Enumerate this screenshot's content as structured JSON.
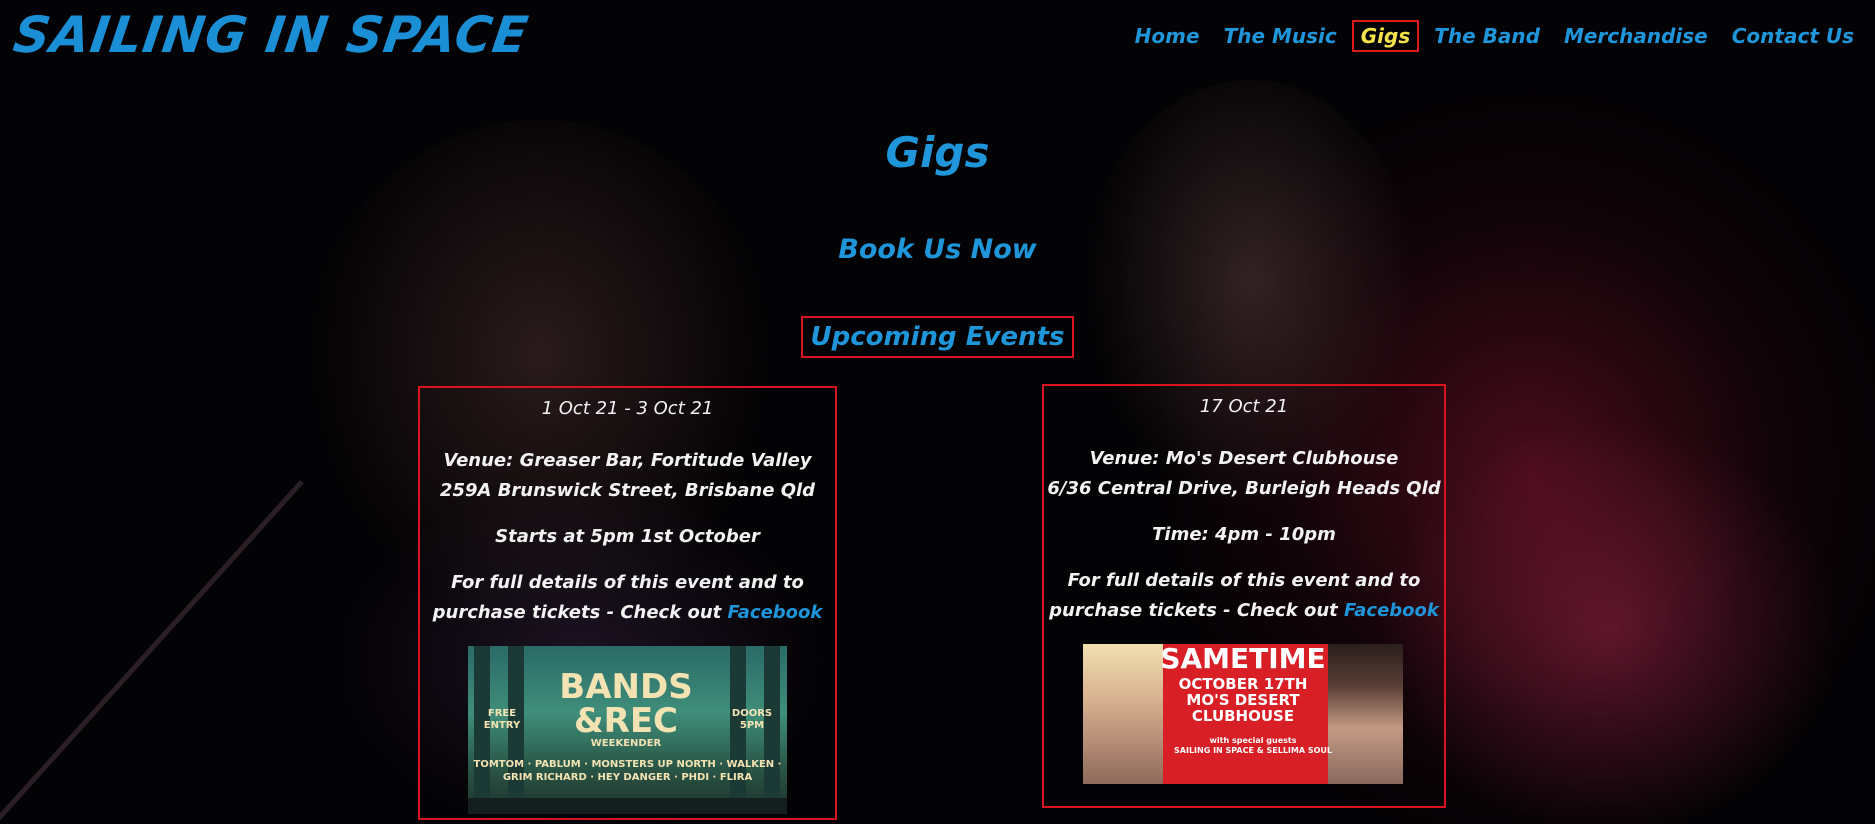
{
  "site": {
    "logo": "SAILING IN SPACE"
  },
  "nav": [
    {
      "label": "Home",
      "active": false
    },
    {
      "label": "The Music",
      "active": false
    },
    {
      "label": "Gigs",
      "active": true
    },
    {
      "label": "The Band",
      "active": false
    },
    {
      "label": "Merchandise",
      "active": false
    },
    {
      "label": "Contact Us",
      "active": false
    }
  ],
  "page": {
    "title": "Gigs",
    "book_link": "Book Us Now",
    "upcoming_heading": "Upcoming Events"
  },
  "events": [
    {
      "date": "1 Oct 21 - 3 Oct 21",
      "venue": "Venue: Greaser Bar, Fortitude Valley",
      "address": "259A Brunswick Street, Brisbane Qld",
      "time": "Starts at 5pm 1st October",
      "details_line1": "For full details of this event and to",
      "details_line2": "purchase tickets - Check out",
      "link_label": "Facebook",
      "poster": {
        "title_line1": "BANDS",
        "title_line2": "&REC",
        "subtitle": "WEEKENDER",
        "badge_left": "FREE ENTRY",
        "badge_right": "DOORS 5PM",
        "lineup": "TOMTOM · PABLUM · MONSTERS UP NORTH · WALKEN · GRIM RICHARD · HEY DANGER · PHDI · FLIRA"
      }
    },
    {
      "date": "17 Oct 21",
      "venue": "Venue: Mo's Desert Clubhouse",
      "address": "6/36 Central Drive, Burleigh Heads Qld",
      "time": "Time: 4pm - 10pm",
      "details_line1": "For full details of this event and to",
      "details_line2": "purchase tickets - Check out",
      "link_label": "Facebook",
      "poster": {
        "headline": "SAMETIME",
        "line1": "OCTOBER 17TH",
        "line2": "MO'S DESERT",
        "line3": "CLUBHOUSE",
        "small1": "with special guests",
        "small2": "SAILING IN SPACE & SELLIMA SOUL"
      }
    }
  ],
  "colors": {
    "accent_blue": "#1f95da",
    "active_yellow": "#f3e24a",
    "border_red": "#d8151c",
    "background": "#030204"
  }
}
